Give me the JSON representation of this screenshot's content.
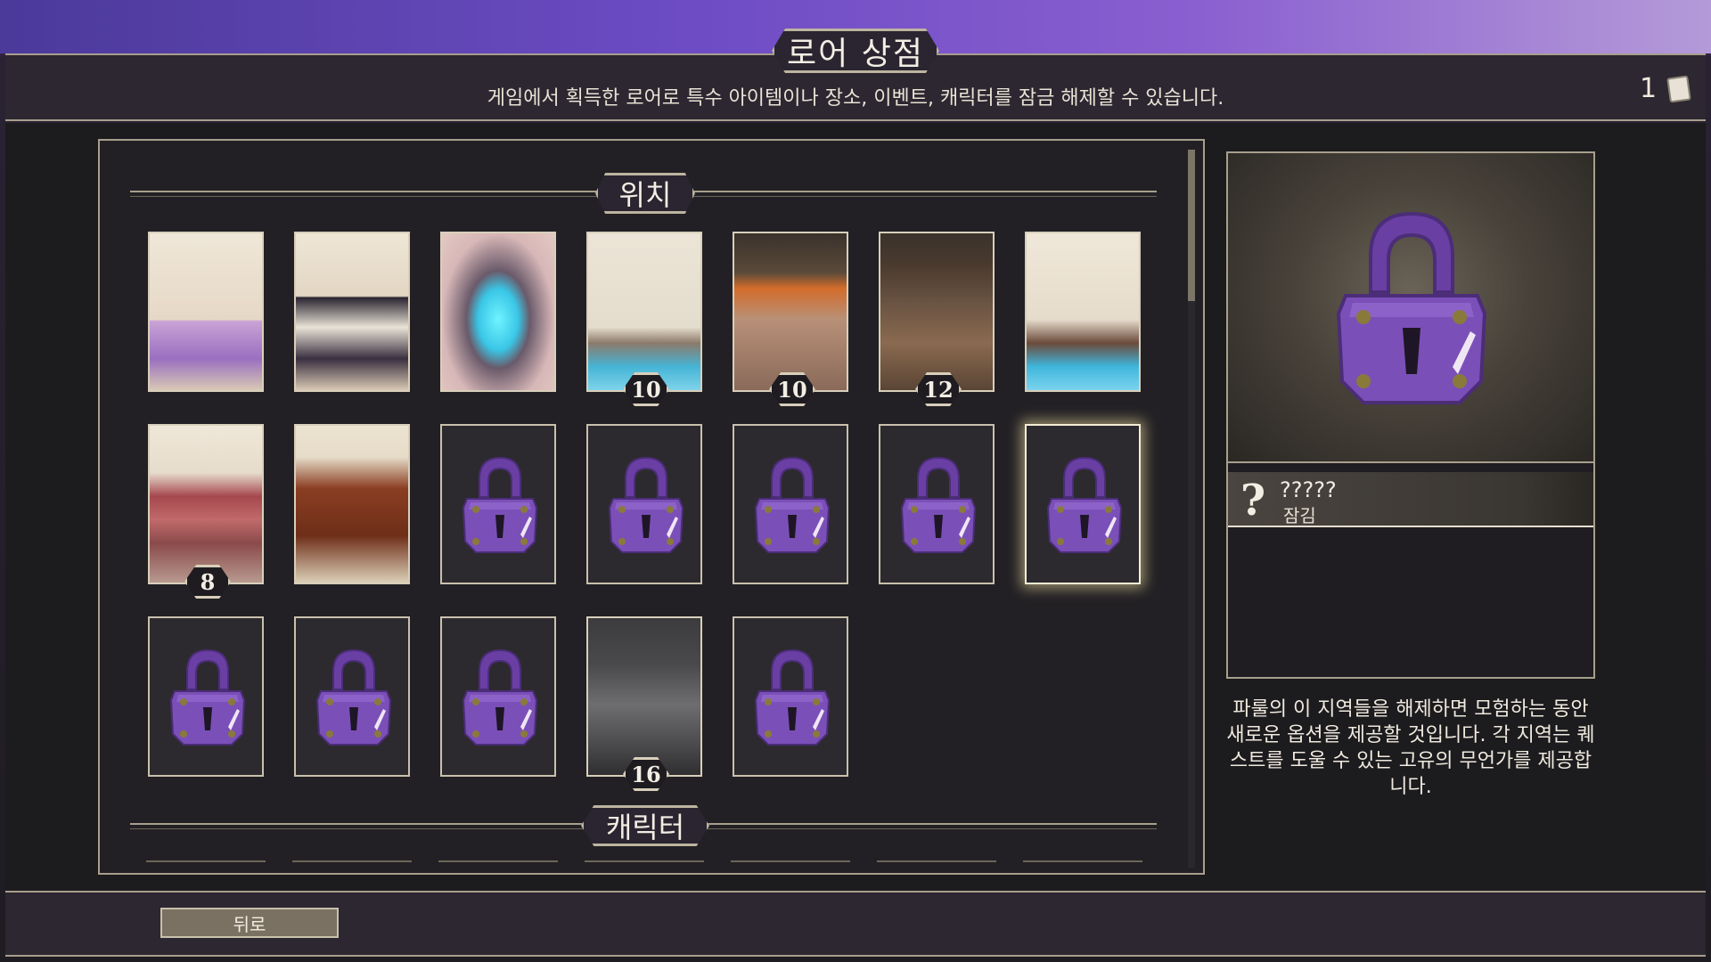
{
  "header": {
    "title": "로어 상점",
    "subtitle": "게임에서 획득한 로어로 특수 아이템이나 장소, 이벤트, 캐릭터를 잠금 해제할 수 있습니다.",
    "lore_count": "1",
    "lore_icon": "scroll-icon"
  },
  "sections": {
    "locations_label": "위치",
    "characters_label": "캐릭터"
  },
  "cards": [
    {
      "name": "market-tent",
      "state": "unlocked",
      "cost": ""
    },
    {
      "name": "festival-tents",
      "state": "unlocked",
      "cost": ""
    },
    {
      "name": "portal-platform",
      "state": "unlocked",
      "cost": ""
    },
    {
      "name": "lighthouse",
      "state": "available",
      "cost": "10"
    },
    {
      "name": "brazier",
      "state": "available",
      "cost": "10"
    },
    {
      "name": "wooden-hut",
      "state": "available",
      "cost": "12"
    },
    {
      "name": "ship",
      "state": "unlocked",
      "cost": ""
    },
    {
      "name": "stone-altar",
      "state": "available",
      "cost": "8"
    },
    {
      "name": "wizard-statue",
      "state": "unlocked",
      "cost": ""
    },
    {
      "name": "locked",
      "state": "locked",
      "cost": ""
    },
    {
      "name": "locked",
      "state": "locked",
      "cost": ""
    },
    {
      "name": "locked",
      "state": "locked",
      "cost": ""
    },
    {
      "name": "locked",
      "state": "locked",
      "cost": ""
    },
    {
      "name": "locked",
      "state": "locked",
      "cost": "",
      "selected": true
    },
    {
      "name": "locked",
      "state": "locked",
      "cost": ""
    },
    {
      "name": "locked",
      "state": "locked",
      "cost": ""
    },
    {
      "name": "locked",
      "state": "locked",
      "cost": ""
    },
    {
      "name": "stone-statue",
      "state": "available",
      "cost": "16"
    },
    {
      "name": "locked",
      "state": "locked",
      "cost": ""
    }
  ],
  "detail": {
    "icon": "question-icon",
    "name": "?????",
    "status": "잠김",
    "description": "파룰의 이 지역들을 해제하면 모험하는 동안 새로운 옵션을 제공할 것입니다. 각 지역는 퀘스트를 도울 수 있는 고유의 무언가를 제공합니다."
  },
  "footer": {
    "back_label": "뒤로"
  },
  "colors": {
    "lock_purple": "#7b4fb8",
    "frame": "#a89f8c",
    "panel_bg": "#222024"
  }
}
